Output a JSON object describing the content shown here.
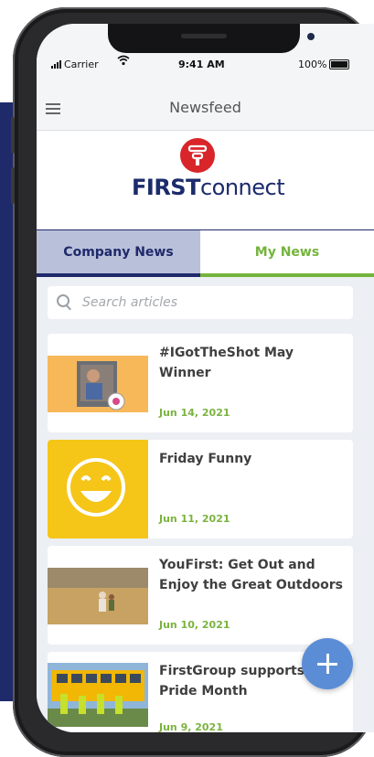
{
  "status_bar": {
    "carrier": "Carrier",
    "time": "9:41 AM",
    "battery": "100%"
  },
  "app_bar": {
    "title": "Newsfeed"
  },
  "logo": {
    "bold": "FIRST",
    "regular": "connect"
  },
  "tabs": [
    {
      "label": "Company News",
      "selected": false
    },
    {
      "label": "My News",
      "selected": true
    }
  ],
  "search": {
    "placeholder": "Search articles"
  },
  "articles": [
    {
      "title": "#IGotTheShot May Winner",
      "date": "Jun 14, 2021"
    },
    {
      "title": "Friday Funny",
      "date": "Jun 11, 2021"
    },
    {
      "title": "YouFirst: Get Out and Enjoy the Great Outdoors",
      "date": "Jun 10, 2021"
    },
    {
      "title": "FirstGroup supports Pride Month",
      "date": "Jun 9, 2021"
    }
  ],
  "colors": {
    "brand_navy": "#1f2a6b",
    "accent_green": "#74b43c",
    "logo_red": "#d9252a",
    "fab_blue": "#5b8dd6"
  }
}
